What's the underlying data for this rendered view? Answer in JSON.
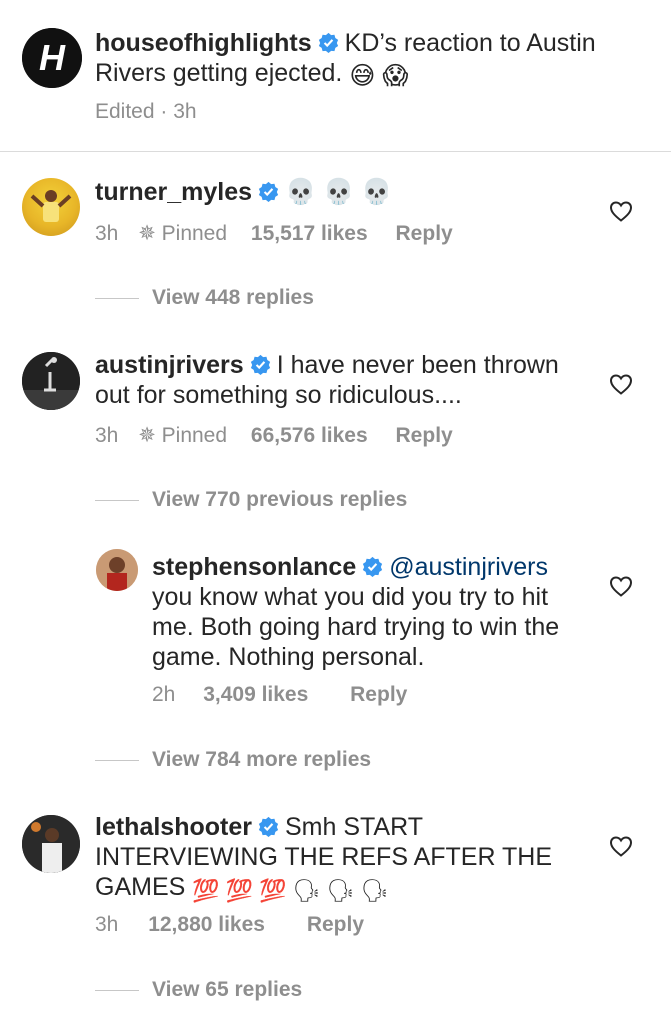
{
  "post": {
    "username": "houseofhighlights",
    "caption": "KD’s reaction to Austin Rivers getting ejected.",
    "caption_emojis": [
      "😅",
      "😱"
    ],
    "meta": "Edited · 3h"
  },
  "comments": [
    {
      "username": "turner_myles",
      "text": "💀 💀 💀",
      "time": "3h",
      "pinned": "Pinned",
      "likes": "15,517 likes",
      "reply": "Reply",
      "view_replies": "View 448 replies"
    },
    {
      "username": "austinjrivers",
      "text": "I have never been thrown out for something so ridiculous....",
      "time": "3h",
      "pinned": "Pinned",
      "likes": "66,576 likes",
      "reply": "Reply",
      "view_replies": "View 770 previous replies",
      "reply_comment": {
        "username": "stephensonlance",
        "mention": "@austinjrivers",
        "text": "you know what you did you try to hit me. Both going hard trying to win the game. Nothing personal.",
        "time": "2h",
        "likes": "3,409 likes",
        "reply": "Reply"
      },
      "view_more": "View 784 more replies"
    },
    {
      "username": "lethalshooter",
      "text": "Smh START INTERVIEWING THE REFS AFTER THE GAMES",
      "emojis": "💯 💯 💯 🗣 🗣 🗣",
      "time": "3h",
      "likes": "12,880 likes",
      "reply": "Reply",
      "view_replies": "View 65 replies"
    }
  ],
  "colors": {
    "verified": "#3897f0",
    "text": "#262626",
    "meta": "#8e8e8e",
    "mention": "#00376b"
  }
}
